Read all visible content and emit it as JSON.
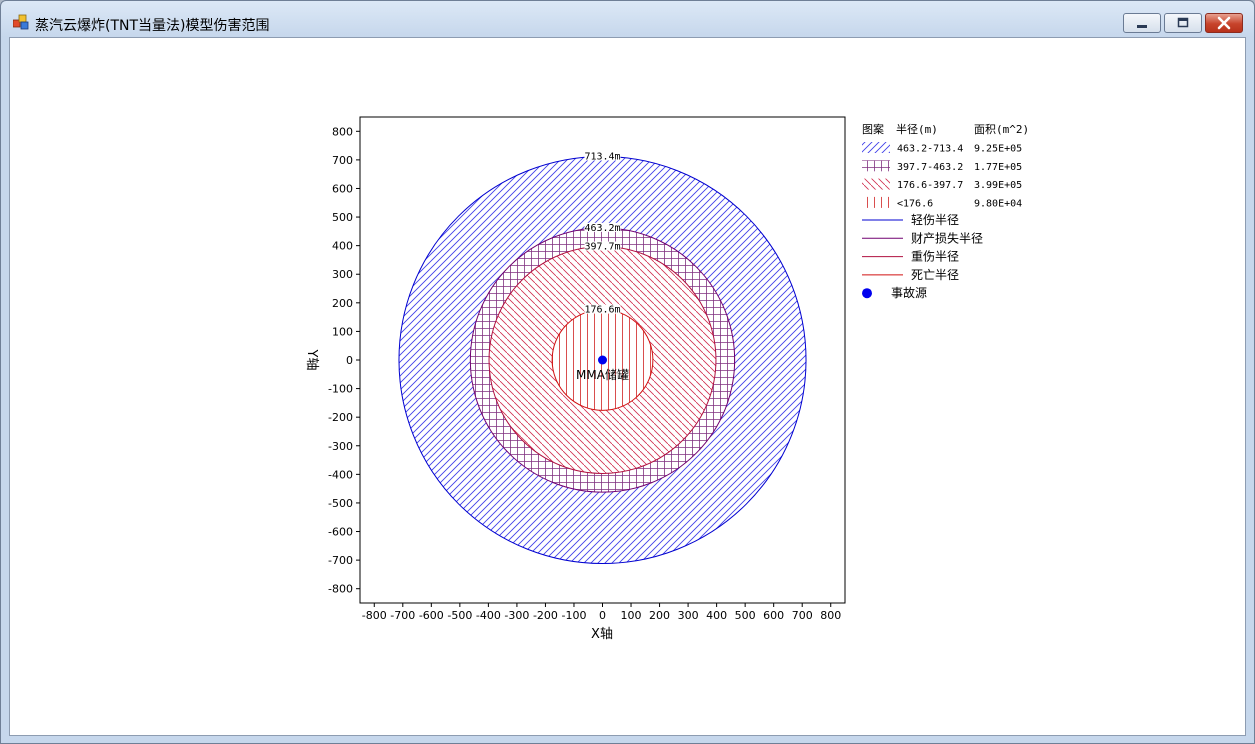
{
  "window": {
    "title": "蒸汽云爆炸(TNT当量法)模型伤害范围"
  },
  "colors": {
    "light_injury": "#0000d0",
    "property_loss": "#700070",
    "serious_injury": "#b01040",
    "death": "#d01010",
    "source": "#0000ee"
  },
  "chart_data": {
    "type": "area",
    "xlabel": "X轴",
    "ylabel": "Y轴",
    "xlim": [
      -850,
      850
    ],
    "ylim": [
      -850,
      850
    ],
    "xticks": [
      -800,
      -700,
      -600,
      -500,
      -400,
      -300,
      -200,
      -100,
      0,
      100,
      200,
      300,
      400,
      500,
      600,
      700,
      800
    ],
    "yticks": [
      800,
      700,
      600,
      500,
      400,
      300,
      200,
      100,
      0,
      -100,
      -200,
      -300,
      -400,
      -500,
      -600,
      -700,
      -800
    ],
    "grid": false,
    "legend_position": "right",
    "circles": [
      {
        "radius": 713.4,
        "label": "713.4m",
        "color": "#0000d0",
        "legend": "轻伤半径",
        "range": "463.2-713.4",
        "area": "9.25E+05",
        "pattern": "diag-up-blue"
      },
      {
        "radius": 463.2,
        "label": "463.2m",
        "color": "#700070",
        "legend": "财产损失半径",
        "range": "397.7-463.2",
        "area": "1.77E+05",
        "pattern": "cross-purple"
      },
      {
        "radius": 397.7,
        "label": "397.7m",
        "color": "#b01040",
        "legend": "重伤半径",
        "range": "176.6-397.7",
        "area": "3.99E+05",
        "pattern": "diag-down-pink"
      },
      {
        "radius": 176.6,
        "label": "176.6m",
        "color": "#d01010",
        "legend": "死亡半径",
        "range": "<176.6",
        "area": "9.80E+04",
        "pattern": "vertical-red"
      }
    ],
    "source": {
      "x": 0,
      "y": 0,
      "label": "MMA储罐",
      "legend": "事故源"
    },
    "legend_headers": {
      "pattern": "图案",
      "radius": "半径(m)",
      "area": "面积(m^2)"
    }
  }
}
